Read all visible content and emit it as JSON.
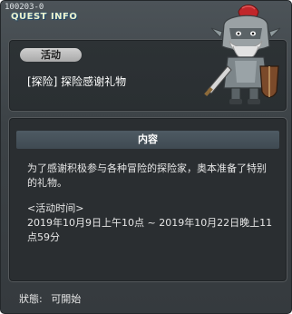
{
  "window": {
    "quest_id": "100203-0",
    "title": "QUEST INFO"
  },
  "quest": {
    "category_pill": "活动",
    "name": "[探险] 探险感谢礼物"
  },
  "content": {
    "header": "内容",
    "description": "为了感谢积极参与各种冒险的探险家，奥本准备了特别的礼物。",
    "time_label": "<活动时间>",
    "time_value": "2019年10月9日上午10点 ~ 2019年10月22日晚上11点59分"
  },
  "status": {
    "label": "狀態:",
    "value": "可開始"
  },
  "mascot": {
    "icon": "armored-knight-icon"
  }
}
